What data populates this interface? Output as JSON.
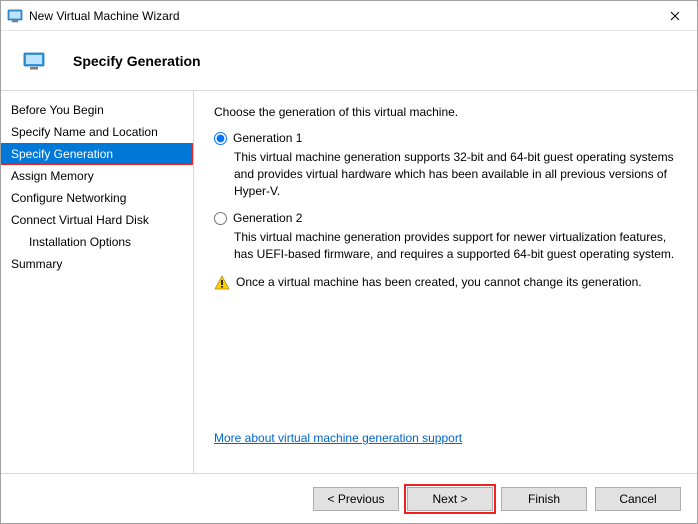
{
  "window": {
    "title": "New Virtual Machine Wizard"
  },
  "header": {
    "title": "Specify Generation"
  },
  "sidebar": {
    "items": [
      {
        "label": "Before You Begin",
        "selected": false,
        "indent": false
      },
      {
        "label": "Specify Name and Location",
        "selected": false,
        "indent": false
      },
      {
        "label": "Specify Generation",
        "selected": true,
        "indent": false
      },
      {
        "label": "Assign Memory",
        "selected": false,
        "indent": false
      },
      {
        "label": "Configure Networking",
        "selected": false,
        "indent": false
      },
      {
        "label": "Connect Virtual Hard Disk",
        "selected": false,
        "indent": false
      },
      {
        "label": "Installation Options",
        "selected": false,
        "indent": true
      },
      {
        "label": "Summary",
        "selected": false,
        "indent": false
      }
    ]
  },
  "content": {
    "intro": "Choose the generation of this virtual machine.",
    "options": [
      {
        "label": "Generation 1",
        "checked": true,
        "description": "This virtual machine generation supports 32-bit and 64-bit guest operating systems and provides virtual hardware which has been available in all previous versions of Hyper-V."
      },
      {
        "label": "Generation 2",
        "checked": false,
        "description": "This virtual machine generation provides support for newer virtualization features, has UEFI-based firmware, and requires a supported 64-bit guest operating system."
      }
    ],
    "warning": "Once a virtual machine has been created, you cannot change its generation.",
    "more_link": "More about virtual machine generation support"
  },
  "footer": {
    "previous": "< Previous",
    "next": "Next >",
    "finish": "Finish",
    "cancel": "Cancel"
  }
}
